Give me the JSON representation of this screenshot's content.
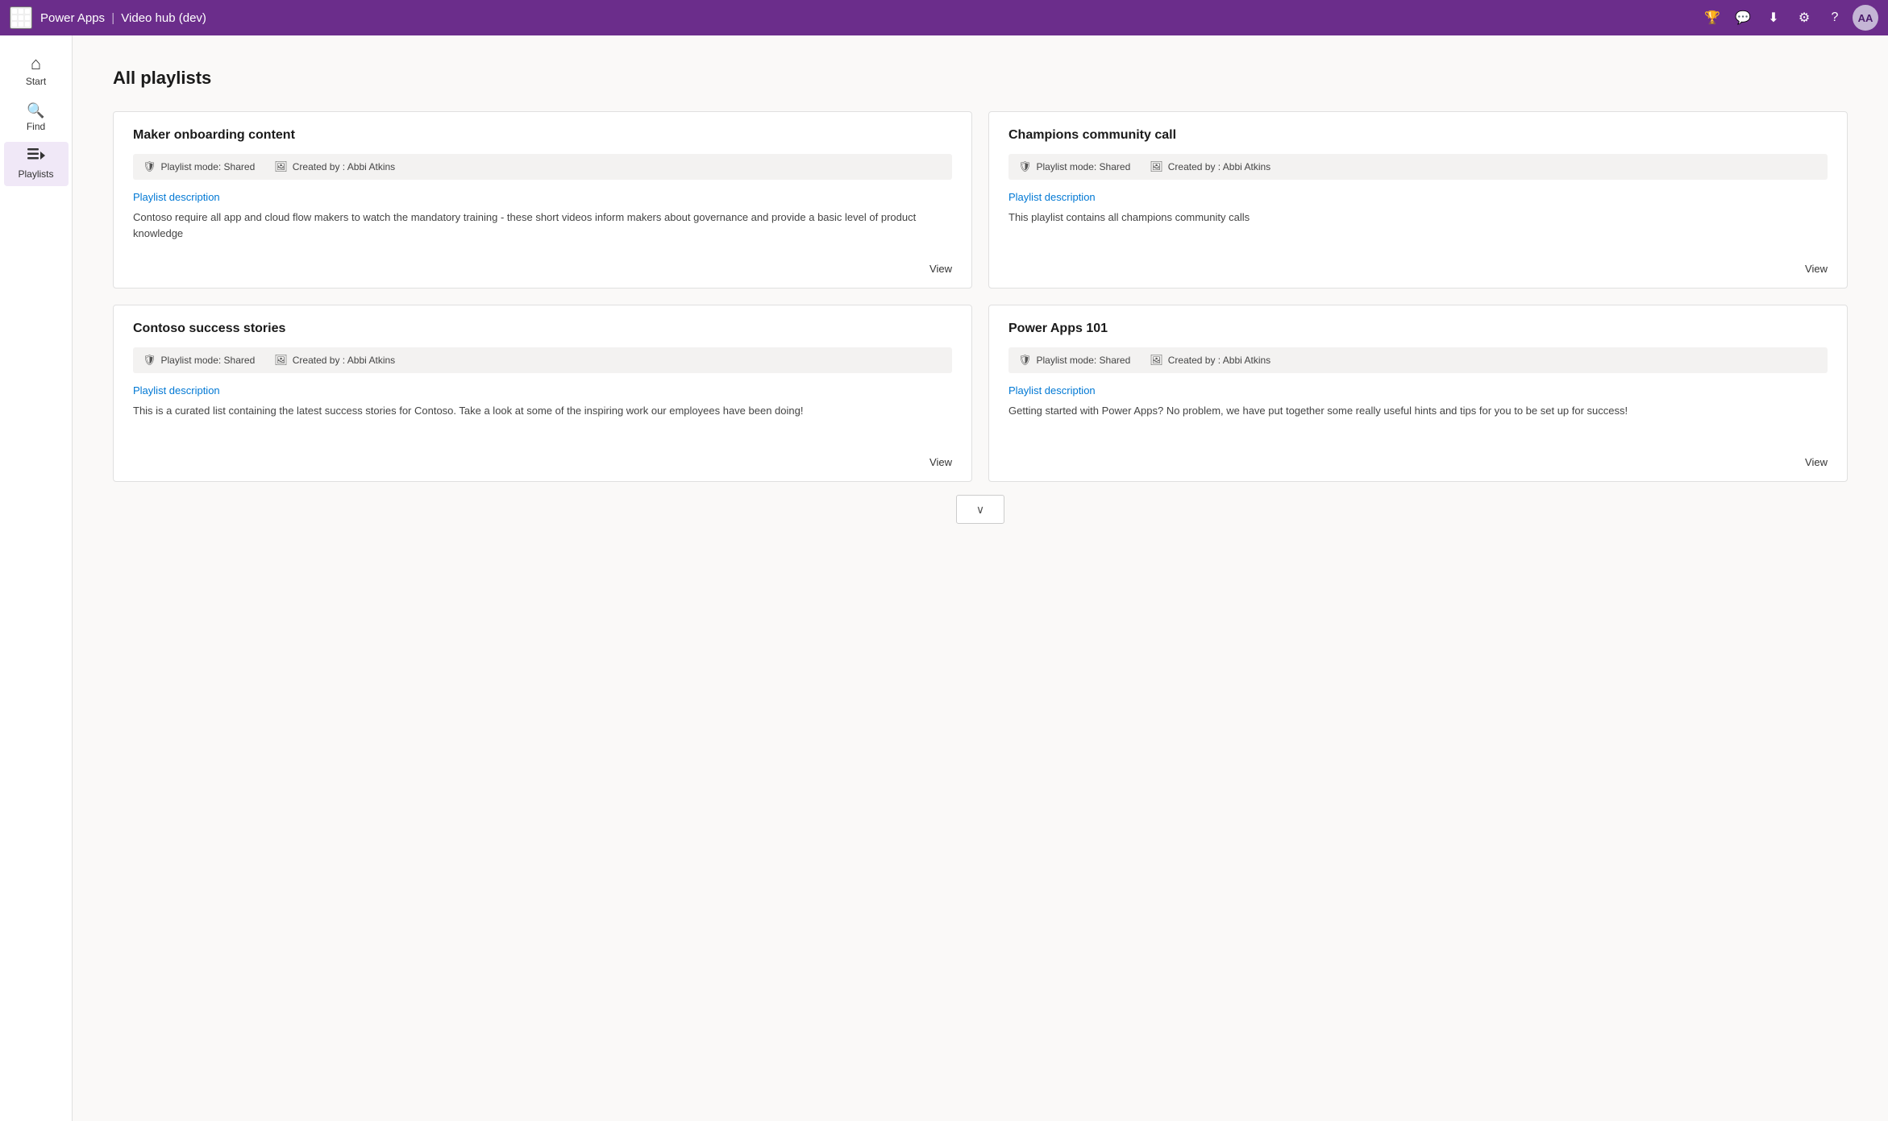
{
  "topbar": {
    "app_name": "Power Apps",
    "separator": "|",
    "app_context": "Video hub (dev)",
    "icons": {
      "badge": "🏆",
      "chat": "💬",
      "download": "⬇",
      "settings": "⚙",
      "help": "?"
    },
    "avatar_label": "AA"
  },
  "sidebar": {
    "items": [
      {
        "id": "start",
        "label": "Start",
        "icon": "⌂"
      },
      {
        "id": "find",
        "label": "Find",
        "icon": "🔍"
      },
      {
        "id": "playlists",
        "label": "Playlists",
        "icon": "≡▶",
        "active": true
      }
    ]
  },
  "main": {
    "page_title": "All playlists",
    "playlists": [
      {
        "id": "maker-onboarding",
        "title": "Maker onboarding content",
        "mode_label": "Playlist mode: Shared",
        "created_label": "Created by : Abbi Atkins",
        "desc_link": "Playlist description",
        "description": "Contoso require all app and cloud flow makers to watch the mandatory training - these short videos inform makers about governance and provide a basic level of product knowledge",
        "view_label": "View"
      },
      {
        "id": "champions-community",
        "title": "Champions community call",
        "mode_label": "Playlist mode: Shared",
        "created_label": "Created by : Abbi Atkins",
        "desc_link": "Playlist description",
        "description": "This playlist contains all champions community calls",
        "view_label": "View"
      },
      {
        "id": "contoso-success",
        "title": "Contoso success stories",
        "mode_label": "Playlist mode: Shared",
        "created_label": "Created by : Abbi Atkins",
        "desc_link": "Playlist description",
        "description": "This is a curated list containing the latest success stories for Contoso.  Take a look at some of the inspiring work our employees have been doing!",
        "view_label": "View"
      },
      {
        "id": "power-apps-101",
        "title": "Power Apps 101",
        "mode_label": "Playlist mode: Shared",
        "created_label": "Created by : Abbi Atkins",
        "desc_link": "Playlist description",
        "description": "Getting started with Power Apps?  No problem, we have put together some really useful hints and tips for you to be set up for success!",
        "view_label": "View"
      }
    ],
    "scroll_btn_label": "∨"
  }
}
